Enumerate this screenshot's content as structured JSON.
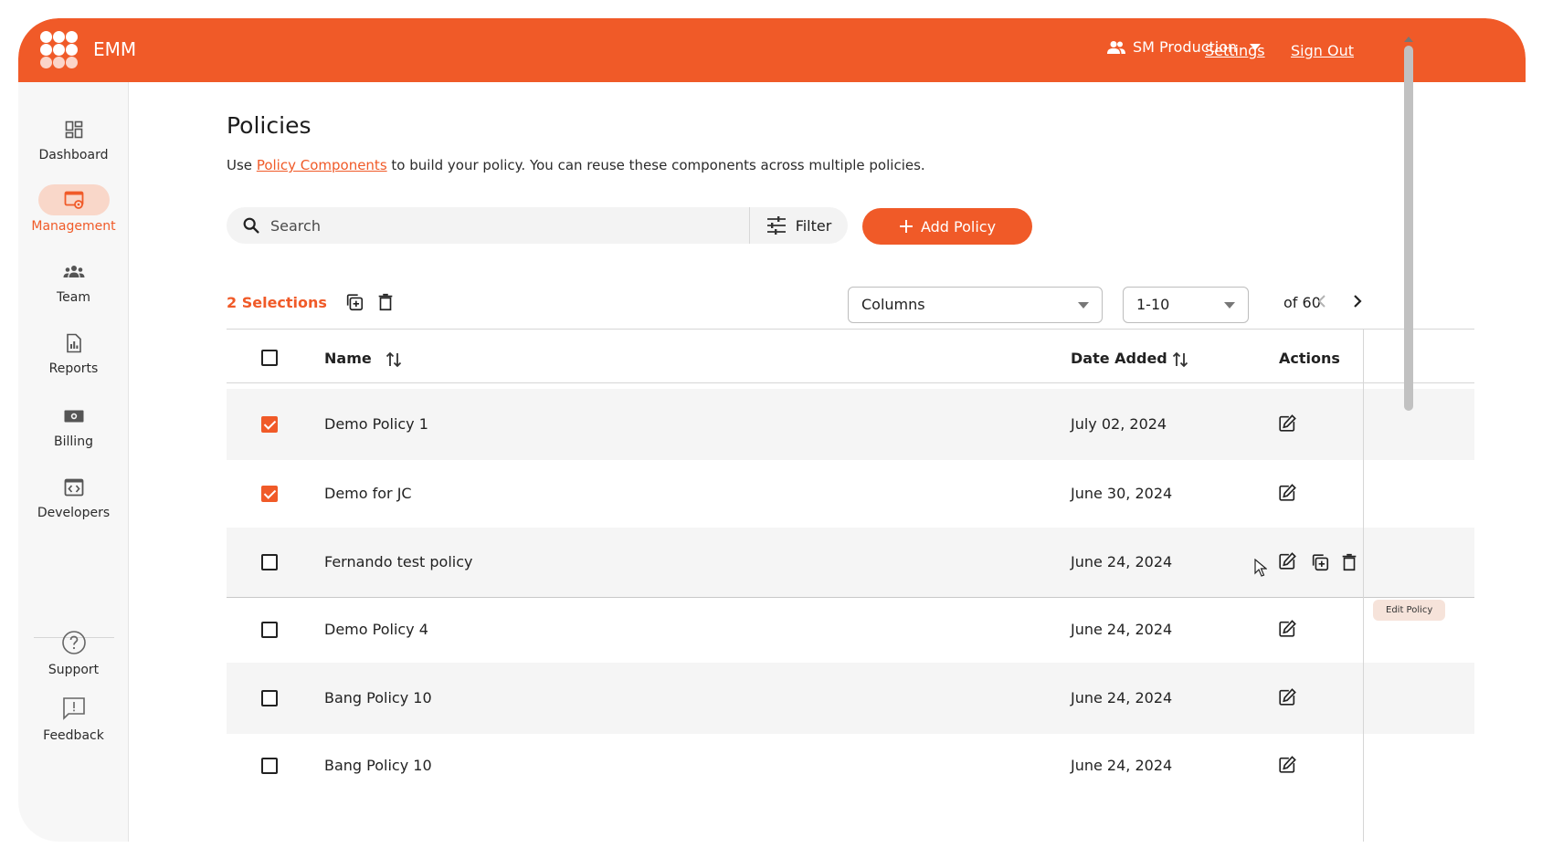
{
  "header": {
    "brand": "EMM",
    "org_name": "SM Production",
    "settings_label": "Settings",
    "signout_label": "Sign Out"
  },
  "sidebar": {
    "items": [
      {
        "label": "Dashboard",
        "icon": "dashboard-icon"
      },
      {
        "label": "Management",
        "icon": "management-icon",
        "active": true
      },
      {
        "label": "Team",
        "icon": "team-icon"
      },
      {
        "label": "Reports",
        "icon": "reports-icon"
      },
      {
        "label": "Billing",
        "icon": "billing-icon"
      },
      {
        "label": "Developers",
        "icon": "developers-icon"
      }
    ],
    "bottom": [
      {
        "label": "Support",
        "icon": "help-icon"
      },
      {
        "label": "Feedback",
        "icon": "feedback-icon"
      }
    ]
  },
  "page": {
    "title": "Policies",
    "subtitle_prefix": "Use",
    "subtitle_link": "Policy Components",
    "subtitle_suffix": "to build your policy. You can reuse these components across multiple policies."
  },
  "search": {
    "placeholder": "Search",
    "filter_label": "Filter"
  },
  "add_button": "Add Policy",
  "toolbar": {
    "selections": "2 Selections",
    "columns_select": "Columns",
    "page_range": "1-10",
    "of_total": "of 60"
  },
  "table": {
    "headers": {
      "name": "Name",
      "date": "Date Added",
      "actions": "Actions"
    },
    "rows": [
      {
        "name": "Demo Policy 1",
        "date": "July 02, 2024",
        "checked": true
      },
      {
        "name": "Demo for JC",
        "date": "June 30, 2024",
        "checked": true
      },
      {
        "name": "Fernando test policy",
        "date": "June 24, 2024",
        "checked": false,
        "hovered": true
      },
      {
        "name": "Demo Policy 4",
        "date": "June 24, 2024",
        "checked": false
      },
      {
        "name": "Bang Policy 10",
        "date": "June 24, 2024",
        "checked": false
      },
      {
        "name": "Bang Policy 10",
        "date": "June 24, 2024",
        "checked": false
      }
    ]
  },
  "tooltip": "Edit Policy",
  "colors": {
    "accent": "#f05a28",
    "active_bg": "#f9d7c9",
    "row_shade": "#f5f5f5"
  }
}
